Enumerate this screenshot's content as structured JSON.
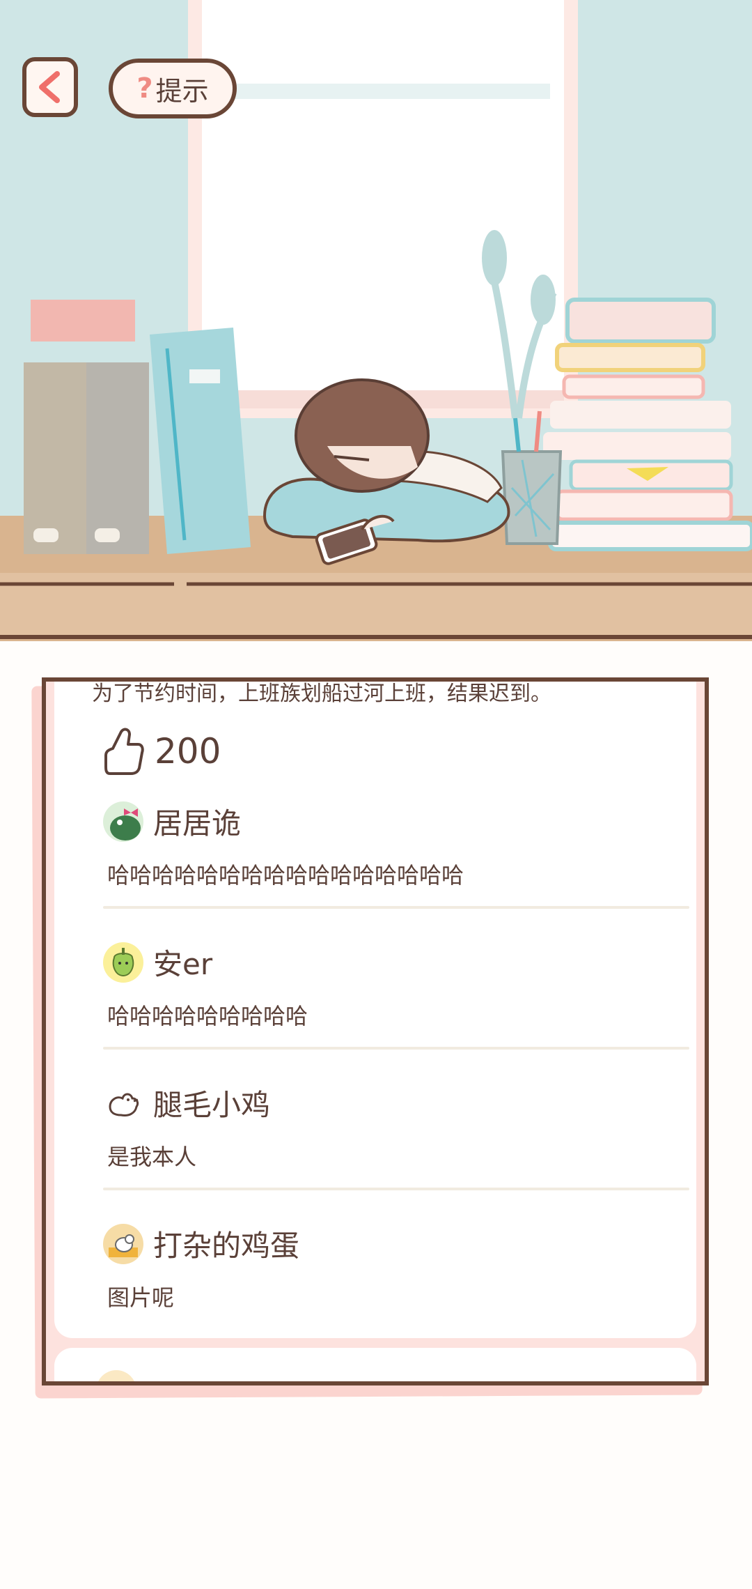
{
  "nav": {
    "back_icon": "chevron-left-icon",
    "hint_label": "提示",
    "hint_icon_glyph": "?"
  },
  "post": {
    "story": "为了节约时间，上班族划船过河上班，结果迟到。",
    "likes": "200",
    "like_icon": "thumbs-up-icon"
  },
  "comments": [
    {
      "name": "居居诡",
      "text": "哈哈哈哈哈哈哈哈哈哈哈哈哈哈哈哈",
      "avatar": "dinosaur-avatar"
    },
    {
      "name": "安er",
      "text": "哈哈哈哈哈哈哈哈哈",
      "avatar": "pepper-avatar"
    },
    {
      "name": "腿毛小鸡",
      "text": "是我本人",
      "avatar": "chick-icon"
    },
    {
      "name": "打杂的鸡蛋",
      "text": "图片呢",
      "avatar": "cat-avatar"
    }
  ],
  "colors": {
    "outline": "#6a4636",
    "accent_pink": "#ef8b83",
    "panel_shadow": "#fbd4cf",
    "wall": "#cfe6e6",
    "desk": "#d9b48f"
  }
}
